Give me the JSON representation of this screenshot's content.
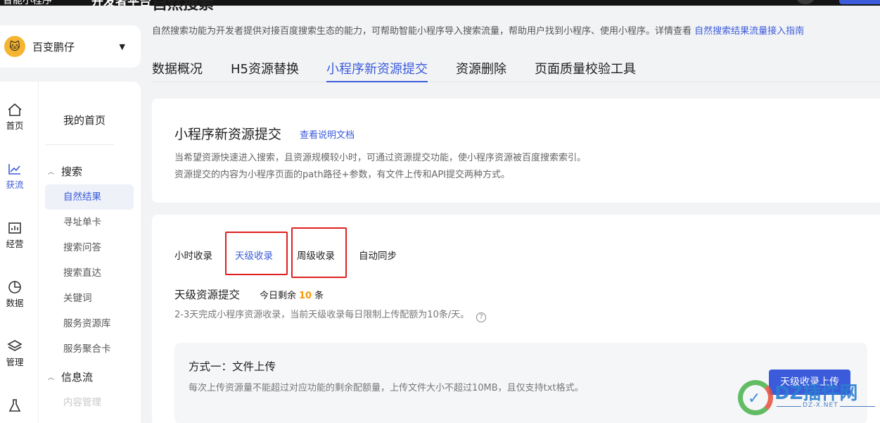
{
  "topbar": {
    "brand": "智能小程序",
    "platform": "开发者平台"
  },
  "account": {
    "avatar_icon": "cat-avatar-icon",
    "name": "百变鹏仔"
  },
  "rail": [
    {
      "label": "首页",
      "icon": "home-icon"
    },
    {
      "label": "获流",
      "icon": "trend-chart-icon"
    },
    {
      "label": "经营",
      "icon": "bar-chart-icon"
    },
    {
      "label": "数据",
      "icon": "pie-chart-icon"
    },
    {
      "label": "管理",
      "icon": "layers-icon"
    },
    {
      "label": "",
      "icon": "flask-icon"
    }
  ],
  "submenu": {
    "home": "我的首页",
    "group_search": "搜索",
    "items": [
      "自然结果",
      "寻址单卡",
      "搜索问答",
      "搜索直达",
      "关键词",
      "服务资源库",
      "服务聚合卡"
    ],
    "group_feed": "信息流",
    "faded_item": "内容管理"
  },
  "header": {
    "title": "自然搜索",
    "intro": "自然搜索功能为开发者提供对接百度搜索生态的能力，可帮助智能小程序导入搜索流量，帮助用户找到小程序、使用小程序。详情查看",
    "intro_link": "自然搜索结果流量接入指南"
  },
  "tabs": [
    "数据概况",
    "H5资源替换",
    "小程序新资源提交",
    "资源删除",
    "页面质量校验工具"
  ],
  "card1": {
    "title": "小程序新资源提交",
    "doc_link": "查看说明文档",
    "desc1": "当希望资源快速进入搜索，且资源规模较小时，可通过资源提交功能，使小程序资源被百度搜索索引。",
    "desc2": "资源提交的内容为小程序页面的path路径+参数，有文件上传和API提交两种方式。"
  },
  "card2": {
    "subtabs": [
      "小时收录",
      "天级收录",
      "周级收录",
      "自动同步"
    ],
    "section_title": "天级资源提交",
    "remain_label": "今日剩余",
    "remain_count": "10",
    "remain_unit": "条",
    "section_desc": "2-3天完成小程序资源收录，当前天级收录每日限制上传配额为10条/天。",
    "help_icon": "question-circle-icon",
    "upload": {
      "title": "方式一：文件上传",
      "desc": "每次上传资源量不能超过对应功能的剩余配额量，上传文件大小不超过10MB，且仅支持txt格式。",
      "button": "天级收录上传"
    }
  },
  "watermark": {
    "text": "DZ插件网",
    "sub": "DZ-X.NET"
  },
  "colors": {
    "accent": "#3b5bdb",
    "highlight_number": "#f59a0b",
    "annotation_box": "#e02020"
  }
}
